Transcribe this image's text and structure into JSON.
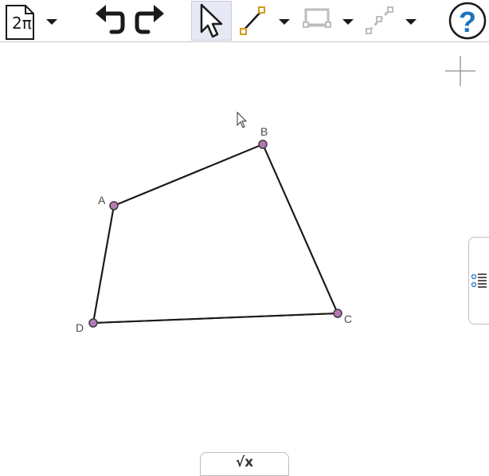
{
  "toolbar": {
    "menu_label": "2π",
    "icons": [
      "menu-icon",
      "undo-icon",
      "redo-icon",
      "move-icon",
      "segment-icon",
      "polygon-icon",
      "line-icon",
      "help-icon"
    ],
    "help_label": "?"
  },
  "points": [
    "A",
    "B",
    "C",
    "D"
  ],
  "input_bar": {
    "label": "√x"
  },
  "colors": {
    "point_fill": "#b57ab5",
    "toolbar_border": "#c8c8c8",
    "help_blue": "#1e73be",
    "segment_orange": "#d09a1a"
  }
}
